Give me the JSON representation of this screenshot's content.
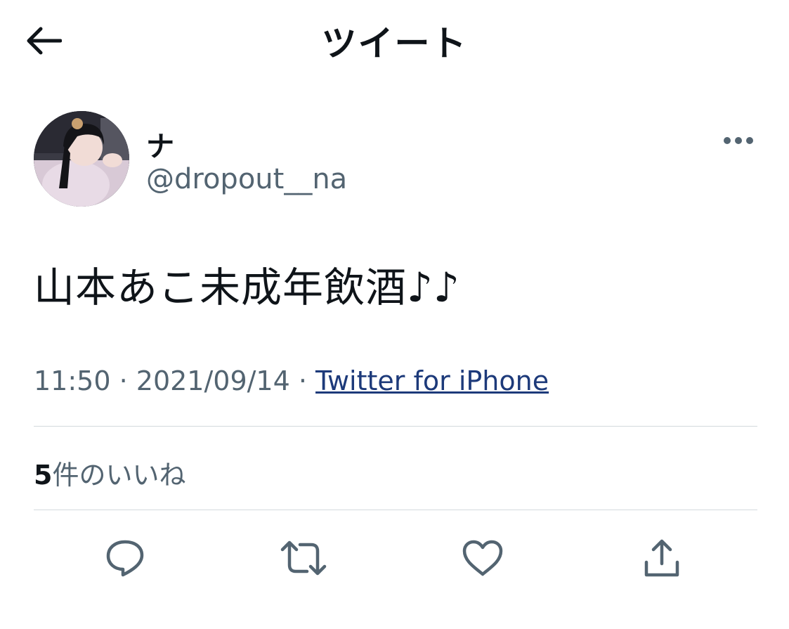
{
  "header": {
    "title": "ツイート",
    "back_icon": "back-arrow-icon"
  },
  "tweet": {
    "author": {
      "display_name": "ナ",
      "handle": "@dropout__na"
    },
    "text": "山本あこ未成年飲酒♪♪",
    "time": "11:50",
    "separator": " · ",
    "date": "2021/09/14",
    "source": "Twitter for iPhone",
    "likes_count": "5",
    "likes_label": "件のいいね"
  },
  "actions": {
    "reply_icon": "reply-icon",
    "retweet_icon": "retweet-icon",
    "like_icon": "heart-icon",
    "share_icon": "share-icon",
    "more_icon": "more-icon"
  },
  "colors": {
    "text": "#0f1419",
    "secondary_text": "#536471",
    "link": "#1d3a7a",
    "divider": "#d3d9dd",
    "background": "#ffffff"
  }
}
